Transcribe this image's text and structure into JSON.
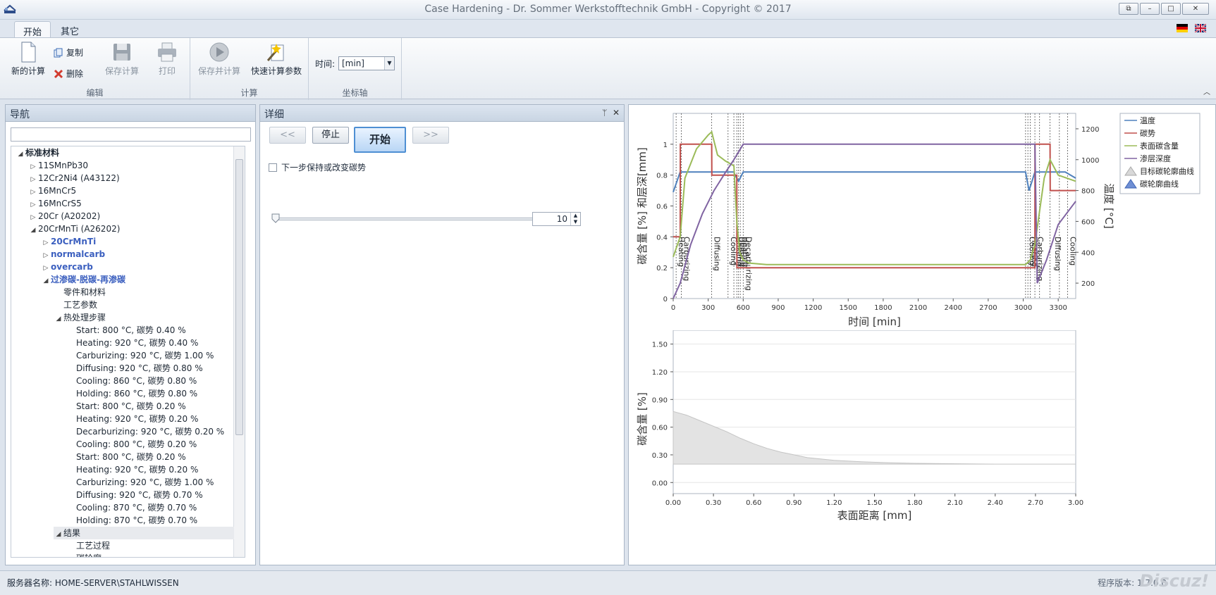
{
  "window": {
    "title": "Case Hardening - Dr. Sommer Werkstofftechnik GmbH - Copyright © 2017"
  },
  "tabs": [
    {
      "label": "开始"
    },
    {
      "label": "其它"
    }
  ],
  "ribbon": {
    "edit": {
      "label": "编辑",
      "new_calc": "新的计算",
      "copy": "复制",
      "delete": "删除",
      "save_calc": "保存计算",
      "print": "打印"
    },
    "calc": {
      "label": "计算",
      "save_and_calc": "保存并计算",
      "quick_params": "快速计算参数"
    },
    "axis": {
      "label": "坐标轴",
      "time_label": "时间:",
      "time_value": "[min]"
    }
  },
  "nav": {
    "title": "导航",
    "tree": [
      {
        "label": "标准材料",
        "level": 0,
        "toggle": "◢",
        "style": "bold"
      },
      {
        "label": "11SMnPb30",
        "level": 1,
        "toggle": "▷",
        "style": ""
      },
      {
        "label": "12Cr2Ni4 (A43122)",
        "level": 1,
        "toggle": "▷",
        "style": ""
      },
      {
        "label": "16MnCr5",
        "level": 1,
        "toggle": "▷",
        "style": ""
      },
      {
        "label": "16MnCrS5",
        "level": 1,
        "toggle": "▷",
        "style": ""
      },
      {
        "label": "20Cr (A20202)",
        "level": 1,
        "toggle": "▷",
        "style": ""
      },
      {
        "label": "20CrMnTi (A26202)",
        "level": 1,
        "toggle": "◢",
        "style": ""
      },
      {
        "label": "20CrMnTi",
        "level": 2,
        "toggle": "▷",
        "style": "blue"
      },
      {
        "label": "normalcarb",
        "level": 2,
        "toggle": "▷",
        "style": "blue"
      },
      {
        "label": "overcarb",
        "level": 2,
        "toggle": "▷",
        "style": "blue"
      },
      {
        "label": "过渗碳-脱碳-再渗碳",
        "level": 2,
        "toggle": "◢",
        "style": "blue"
      },
      {
        "label": "零件和材料",
        "level": 3,
        "toggle": "",
        "style": ""
      },
      {
        "label": "工艺参数",
        "level": 3,
        "toggle": "",
        "style": ""
      },
      {
        "label": "热处理步骤",
        "level": 3,
        "toggle": "◢",
        "style": ""
      },
      {
        "label": "Start:  800 °C,  碳势 0.40 %",
        "level": 4,
        "toggle": "",
        "style": ""
      },
      {
        "label": "Heating:  920 °C,  碳势 0.40 %",
        "level": 4,
        "toggle": "",
        "style": ""
      },
      {
        "label": "Carburizing:  920 °C,  碳势 1.00 %",
        "level": 4,
        "toggle": "",
        "style": ""
      },
      {
        "label": "Diffusing:  920 °C,  碳势 0.80 %",
        "level": 4,
        "toggle": "",
        "style": ""
      },
      {
        "label": "Cooling:  860 °C,  碳势 0.80 %",
        "level": 4,
        "toggle": "",
        "style": ""
      },
      {
        "label": "Holding:  860 °C,  碳势 0.80 %",
        "level": 4,
        "toggle": "",
        "style": ""
      },
      {
        "label": "Start:  800 °C,  碳势 0.20 %",
        "level": 4,
        "toggle": "",
        "style": ""
      },
      {
        "label": "Heating:  920 °C,  碳势 0.20 %",
        "level": 4,
        "toggle": "",
        "style": ""
      },
      {
        "label": "Decarburizing:  920 °C,  碳势 0.20 %",
        "level": 4,
        "toggle": "",
        "style": ""
      },
      {
        "label": "Cooling:  800 °C,  碳势 0.20 %",
        "level": 4,
        "toggle": "",
        "style": ""
      },
      {
        "label": "Start:  800 °C,  碳势 0.20 %",
        "level": 4,
        "toggle": "",
        "style": ""
      },
      {
        "label": "Heating:  920 °C,  碳势 0.20 %",
        "level": 4,
        "toggle": "",
        "style": ""
      },
      {
        "label": "Carburizing:  920 °C,  碳势 1.00 %",
        "level": 4,
        "toggle": "",
        "style": ""
      },
      {
        "label": "Diffusing:  920 °C,  碳势 0.70 %",
        "level": 4,
        "toggle": "",
        "style": ""
      },
      {
        "label": "Cooling:  870 °C,  碳势 0.70 %",
        "level": 4,
        "toggle": "",
        "style": ""
      },
      {
        "label": "Holding:  870 °C,  碳势 0.70 %",
        "level": 4,
        "toggle": "",
        "style": ""
      },
      {
        "label": "结果",
        "level": 3,
        "toggle": "◢",
        "style": "sel"
      },
      {
        "label": "工艺过程",
        "level": 4,
        "toggle": "",
        "style": ""
      },
      {
        "label": "碳轮廓",
        "level": 4,
        "toggle": "",
        "style": ""
      }
    ]
  },
  "details": {
    "title": "详细",
    "prev": "<<",
    "stop": "停止",
    "start": "开始",
    "next": ">>",
    "checkbox_label": "下一步保持或改变碳势",
    "spin_value": "10"
  },
  "status": {
    "server": "服务器名称: HOME-SERVER\\STAHLWISSEN",
    "version": "程序版本: 1.7.0.0",
    "watermark": "Discuz!"
  },
  "chart_data": [
    {
      "type": "line",
      "xlabel": "时间 [min]",
      "ylabel": "碳含量 [%] 和层深[mm]",
      "y2label": "温度 [°C]",
      "xlim": [
        0,
        3450
      ],
      "ylim": [
        0,
        1.2
      ],
      "y2lim": [
        100,
        1300
      ],
      "xticks": [
        0,
        300,
        600,
        900,
        1200,
        1500,
        1800,
        2100,
        2400,
        2700,
        3000,
        3300
      ],
      "yticks": [
        0,
        0.2,
        0.4,
        0.6,
        0.8,
        1
      ],
      "y2ticks": [
        200,
        400,
        600,
        800,
        1000,
        1200
      ],
      "legend": [
        "温度",
        "碳势",
        "表面碳含量",
        "渗层深度",
        "目标碳轮廓曲线",
        "碳轮廓曲线"
      ],
      "legend_position": "right",
      "colors": {
        "temp": "#4f81bd",
        "cp": "#c0504d",
        "surface": "#9bbb59",
        "depth": "#8064a2"
      },
      "step_labels": [
        {
          "x": 25,
          "label": "Heating"
        },
        {
          "x": 70,
          "label": "Carburizing"
        },
        {
          "x": 330,
          "label": "Diffusing"
        },
        {
          "x": 470,
          "label": "Cooling"
        },
        {
          "x": 520,
          "label": "Holding"
        },
        {
          "x": 545,
          "label": "Heating"
        },
        {
          "x": 560,
          "label": "Heating"
        },
        {
          "x": 575,
          "label": "Heating"
        },
        {
          "x": 600,
          "label": "Decarburizing"
        },
        {
          "x": 3030,
          "label": "Cooling"
        },
        {
          "x": 3050,
          "label": "Heating"
        },
        {
          "x": 3100,
          "label": "Carburizing"
        },
        {
          "x": 3250,
          "label": "Diffusing"
        },
        {
          "x": 3380,
          "label": "Cooling"
        }
      ],
      "step_lines": [
        25,
        70,
        330,
        470,
        520,
        545,
        560,
        575,
        600,
        3020,
        3040,
        3060,
        3100,
        3140,
        3230,
        3310,
        3380
      ],
      "series": [
        {
          "name": "温度",
          "axis": "y2",
          "x": [
            0,
            60,
            75,
            520,
            530,
            560,
            600,
            3020,
            3050,
            3100,
            3125,
            3360,
            3450
          ],
          "values": [
            790,
            920,
            920,
            920,
            900,
            860,
            920,
            920,
            800,
            920,
            920,
            920,
            880
          ]
        },
        {
          "name": "碳势",
          "axis": "y",
          "x": [
            0,
            60,
            61,
            330,
            331,
            545,
            546,
            3100,
            3101,
            3230,
            3231,
            3450
          ],
          "values": [
            0.4,
            0.4,
            1.0,
            1.0,
            0.8,
            0.8,
            0.2,
            0.2,
            1.0,
            1.0,
            0.7,
            0.7
          ]
        },
        {
          "name": "表面碳含量",
          "axis": "y",
          "x": [
            0,
            60,
            100,
            200,
            300,
            330,
            380,
            450,
            520,
            545,
            570,
            600,
            650,
            800,
            3020,
            3060,
            3100,
            3180,
            3230,
            3300,
            3450
          ],
          "values": [
            0.27,
            0.4,
            0.78,
            0.97,
            1.06,
            1.08,
            0.93,
            0.89,
            0.86,
            0.5,
            0.3,
            0.25,
            0.23,
            0.22,
            0.22,
            0.25,
            0.35,
            0.78,
            0.9,
            0.8,
            0.76
          ]
        },
        {
          "name": "渗层深度",
          "axis": "y",
          "x": [
            0,
            60,
            150,
            250,
            350,
            450,
            520,
            560,
            600,
            3100,
            3120,
            3200,
            3300,
            3450
          ],
          "values": [
            0,
            0.1,
            0.35,
            0.55,
            0.7,
            0.82,
            0.9,
            0.95,
            1.0,
            1.0,
            0.1,
            0.25,
            0.48,
            0.63
          ]
        }
      ]
    },
    {
      "type": "area",
      "xlabel": "表面距离 [mm]",
      "ylabel": "碳含量 [%]",
      "xlim": [
        0,
        3
      ],
      "ylim": [
        -0.12,
        1.65
      ],
      "xticks": [
        0,
        0.3,
        0.6,
        0.9,
        1.2,
        1.5,
        1.8,
        2.1,
        2.4,
        2.7,
        3.0
      ],
      "yticks": [
        0,
        0.3,
        0.6,
        0.9,
        1.2,
        1.5
      ],
      "series": [
        {
          "name": "碳轮廓曲线",
          "x": [
            0,
            0.1,
            0.2,
            0.3,
            0.4,
            0.5,
            0.6,
            0.7,
            0.8,
            0.9,
            1.0,
            1.2,
            1.4,
            1.6,
            1.8,
            2.0,
            2.4,
            2.8,
            3.0
          ],
          "values": [
            0.77,
            0.73,
            0.67,
            0.61,
            0.55,
            0.48,
            0.42,
            0.37,
            0.33,
            0.3,
            0.27,
            0.24,
            0.225,
            0.215,
            0.208,
            0.205,
            0.2,
            0.2,
            0.2
          ]
        }
      ],
      "baseline": 0.2
    }
  ]
}
